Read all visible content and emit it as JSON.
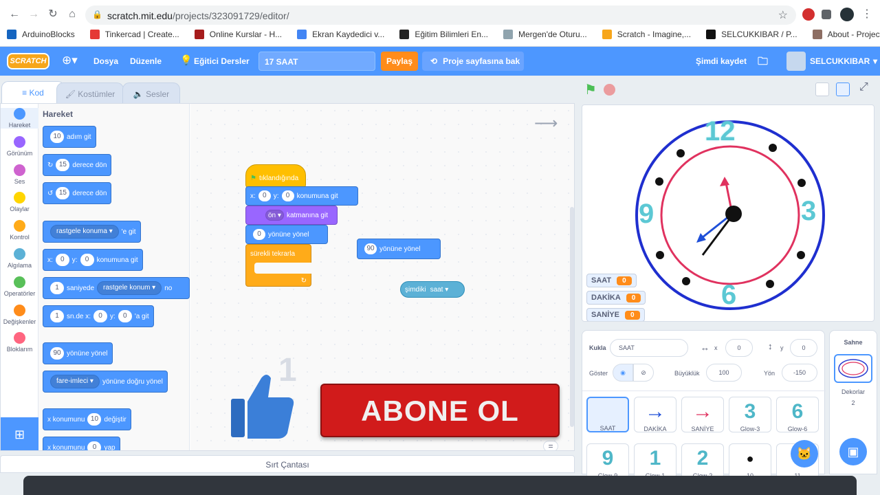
{
  "browser": {
    "url_domain": "scratch.mit.edu",
    "url_path": "/projects/323091729/editor/",
    "bookmarks": [
      {
        "label": "ArduinoBlocks",
        "color": "#1565c0"
      },
      {
        "label": "Tinkercad | Create...",
        "color": "#e53935"
      },
      {
        "label": "Online Kurslar - H...",
        "color": "#a61c1c"
      },
      {
        "label": "Ekran Kaydedici v...",
        "color": "#4285f4"
      },
      {
        "label": "Eğitim Bilimleri En...",
        "color": "#222222"
      },
      {
        "label": "Mergen'de Oturu...",
        "color": "#90a4ae"
      },
      {
        "label": "Scratch - Imagine,...",
        "color": "#f7a61b"
      },
      {
        "label": "SELCUKKIBAR / P...",
        "color": "#111111"
      },
      {
        "label": "About - Project Eu...",
        "color": "#8d6e63"
      }
    ],
    "more": "»"
  },
  "menubar": {
    "logo": "SCRATCH",
    "file": "Dosya",
    "edit": "Düzenle",
    "tutorials": "Eğitici Dersler",
    "project_title": "17 SAAT",
    "share": "Paylaş",
    "project_page": "Proje sayfasına bak",
    "save_now": "Şimdi kaydet",
    "username": "SELCUKKIBAR"
  },
  "tabs": {
    "code": "Kod",
    "costumes": "Kostümler",
    "sounds": "Sesler"
  },
  "categories": [
    {
      "label": "Hareket",
      "color": "#4c97ff"
    },
    {
      "label": "Görünüm",
      "color": "#9966ff"
    },
    {
      "label": "Ses",
      "color": "#cf63cf"
    },
    {
      "label": "Olaylar",
      "color": "#ffd500"
    },
    {
      "label": "Kontrol",
      "color": "#ffab19"
    },
    {
      "label": "Algılama",
      "color": "#5cb1d6"
    },
    {
      "label": "Operatörler",
      "color": "#59c059"
    },
    {
      "label": "Değişkenler",
      "color": "#ff8c1a"
    },
    {
      "label": "Bloklarım",
      "color": "#ff6680"
    }
  ],
  "palette": {
    "title": "Hareket",
    "b1": {
      "num": "10",
      "text": "adım git"
    },
    "b2": {
      "num": "15",
      "text": "derece dön"
    },
    "b3": {
      "num": "15",
      "text": "derece dön"
    },
    "b4": {
      "dd": "rastgele konuma",
      "text": "'e git"
    },
    "b5": {
      "x": "x:",
      "xv": "0",
      "y": "y:",
      "yv": "0",
      "text": "konumuna git"
    },
    "b6": {
      "num": "1",
      "text": "saniyede",
      "dd": "rastgele konum",
      "tail": "no"
    },
    "b7": {
      "num": "1",
      "text": "sn.de x:",
      "xv": "0",
      "y": "y:",
      "yv": "0",
      "tail": "'a git"
    },
    "b8": {
      "num": "90",
      "text": "yönüne yönel"
    },
    "b9": {
      "dd": "fare-imleci",
      "text": "yönüne doğru yönel"
    },
    "b10": {
      "text": "x konumunu",
      "num": "10",
      "tail": "değiştir"
    },
    "b11": {
      "text": "x konumunu",
      "num": "0",
      "tail": "yap"
    }
  },
  "workspace": {
    "hat": "tıklandığında",
    "goto": {
      "x": "x:",
      "xv": "0",
      "y": "y:",
      "yv": "0",
      "text": "konumuna git"
    },
    "layer": {
      "dd": "ön",
      "text": "katmanına git"
    },
    "point": {
      "num": "0",
      "text": "yönüne yönel"
    },
    "forever": "sürekli tekrarla",
    "loose_point": {
      "num": "90",
      "text": "yönüne yönel"
    },
    "now": {
      "text": "şimdiki",
      "dd": "saat"
    },
    "zoom_eq": "="
  },
  "overlay": {
    "subscribe": "ABONE OL",
    "like_count": "1"
  },
  "stage": {
    "numbers": [
      "12",
      "3",
      "6",
      "9"
    ],
    "monitors": [
      {
        "label": "SAAT",
        "value": "0"
      },
      {
        "label": "DAKİKA",
        "value": "0"
      },
      {
        "label": "SANİYE",
        "value": "0"
      }
    ]
  },
  "sprite_info": {
    "sprite_label": "Kukla",
    "sprite_name": "SAAT",
    "x_label": "x",
    "x_value": "0",
    "y_label": "y",
    "y_value": "0",
    "show_label": "Göster",
    "size_label": "Büyüklük",
    "size_value": "100",
    "dir_label": "Yön",
    "dir_value": "-150"
  },
  "sprites": [
    {
      "name": "SAAT",
      "glyph": ""
    },
    {
      "name": "DAKİKA",
      "glyph": "→"
    },
    {
      "name": "SANİYE",
      "glyph": "→"
    },
    {
      "name": "Glow-3",
      "glyph": "3"
    },
    {
      "name": "Glow-6",
      "glyph": "6"
    },
    {
      "name": "Glow-9",
      "glyph": "9"
    },
    {
      "name": "Glow-1",
      "glyph": "1"
    },
    {
      "name": "Glow-2",
      "glyph": "2"
    },
    {
      "name": "10",
      "glyph": "●"
    },
    {
      "name": "11",
      "glyph": ""
    }
  ],
  "backdrop": {
    "title": "Sahne",
    "label": "Dekorlar",
    "count": "2"
  },
  "backpack": "Sırt Çantası"
}
